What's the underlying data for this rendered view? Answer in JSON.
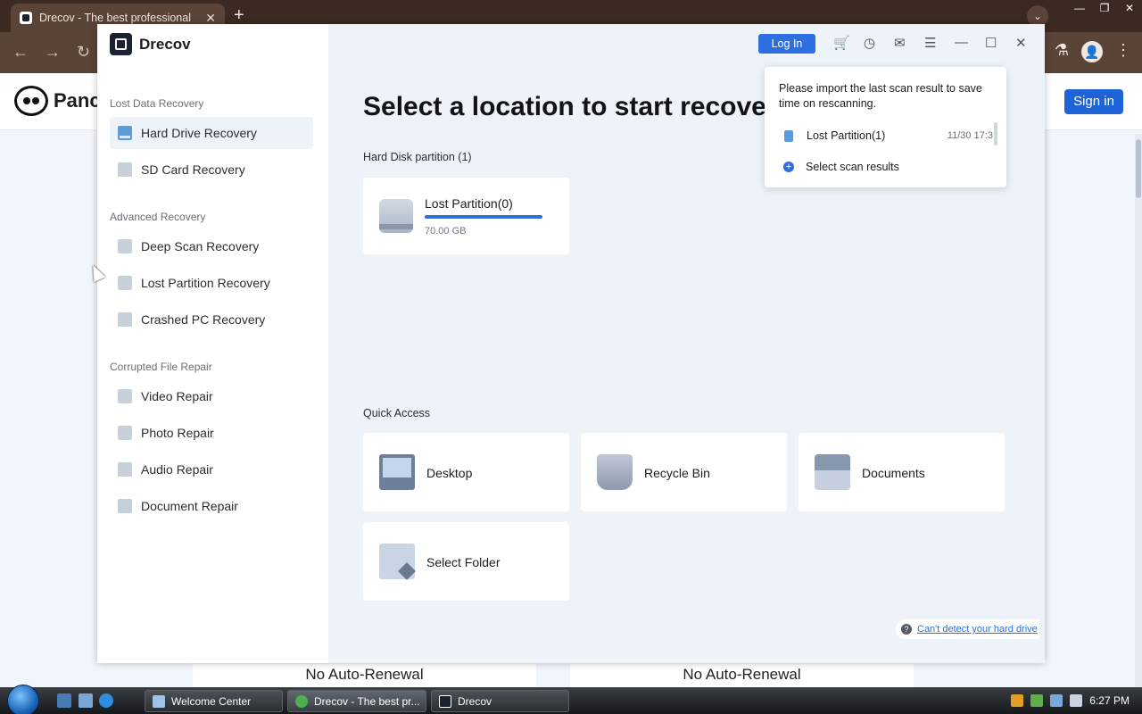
{
  "browser": {
    "tab_title": "Drecov - The best professional",
    "tab_close": "✕",
    "new_tab": "+",
    "tabs_dropdown": "⌄",
    "window_controls": [
      "—",
      "❐",
      "✕"
    ],
    "nav": {
      "back": "←",
      "forward": "→",
      "reload": "↻"
    },
    "toolbar_icons": {
      "labs": "⚗",
      "profile": "👤",
      "menu": "⋮"
    }
  },
  "webpage": {
    "logo_text": "Panc",
    "sign_in": "Sign in",
    "price_cards": [
      "No Auto-Renewal",
      "No Auto-Renewal"
    ]
  },
  "app": {
    "brand": "Drecov",
    "sidebar": {
      "sections": [
        {
          "title": "Lost Data Recovery",
          "items": [
            "Hard Drive Recovery",
            "SD Card Recovery"
          ]
        },
        {
          "title": "Advanced Recovery",
          "items": [
            "Deep Scan Recovery",
            "Lost Partition Recovery",
            "Crashed PC Recovery"
          ]
        },
        {
          "title": "Corrupted File Repair",
          "items": [
            "Video Repair",
            "Photo Repair",
            "Audio Repair",
            "Document Repair"
          ]
        }
      ],
      "active_item": "Hard Drive Recovery"
    },
    "topbar": {
      "login": "Log In",
      "icons": {
        "cart": "🛒",
        "history": "◷",
        "mail": "✉",
        "menu": "☰",
        "minimize": "—",
        "maximize": "☐",
        "close": "✕"
      }
    },
    "title": "Select a location to start recover",
    "hard_disk_label": "Hard Disk partition (1)",
    "disk": {
      "name": "Lost Partition(0)",
      "size": "70.00 GB",
      "used_fraction": 1.0
    },
    "quick_access_label": "Quick Access",
    "quick_access": [
      "Desktop",
      "Recycle Bin",
      "Documents",
      "Select Folder"
    ],
    "help_link": "Can't detect your hard drive",
    "help_icon": "?",
    "popup": {
      "message": "Please import the last scan result to save time on rescanning.",
      "scan_name": "Lost Partition(1)",
      "scan_time": "11/30 17:3",
      "select_results": "Select scan results",
      "plus": "+"
    }
  },
  "taskbar": {
    "buttons": [
      "Welcome Center",
      "Drecov - The best pr...",
      "Drecov"
    ],
    "clock": "6:27 PM"
  }
}
